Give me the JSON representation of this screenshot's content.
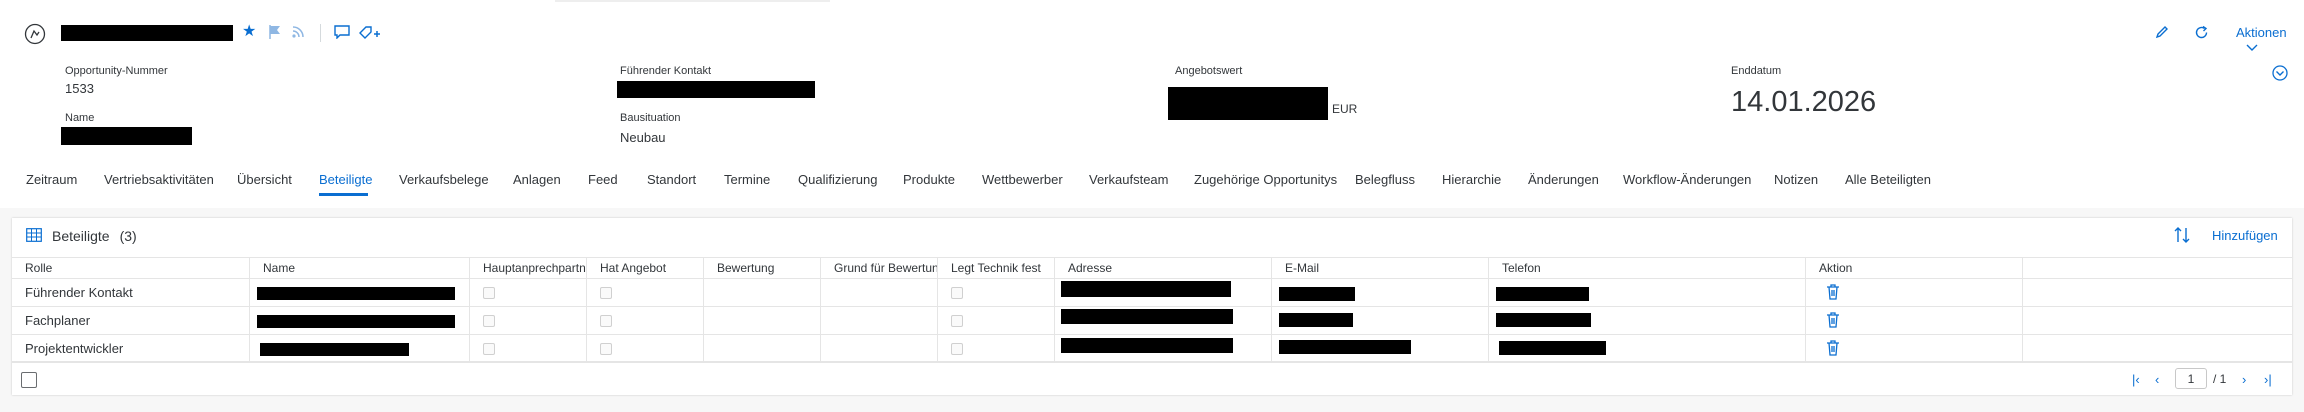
{
  "header": {
    "fields": {
      "opportunity_label": "Opportunity-Nummer",
      "opportunity_value": "1533",
      "name_label": "Name",
      "contact_label": "Führender Kontakt",
      "situation_label": "Bausituation",
      "situation_value": "Neubau",
      "offer_label": "Angebotswert",
      "offer_currency": "EUR",
      "end_label": "Enddatum",
      "end_value": "14.01.2026"
    },
    "actions_label": "Aktionen",
    "icons": [
      "star-icon",
      "flag-icon",
      "rss-icon",
      "comment-icon",
      "tag-add-icon",
      "edit-icon",
      "refresh-icon",
      "expand-icon"
    ]
  },
  "tabs": [
    "Zeitraum",
    "Vertriebsaktivitäten",
    "Übersicht",
    "Beteiligte",
    "Verkaufsbelege",
    "Anlagen",
    "Feed",
    "Standort",
    "Termine",
    "Qualifizierung",
    "Produkte",
    "Wettbewerber",
    "Verkaufsteam",
    "Zugehörige Opportunitys",
    "Belegfluss",
    "Hierarchie",
    "Änderungen",
    "Workflow-Änderungen",
    "Notizen",
    "Alle Beteiligten"
  ],
  "active_tab": "Beteiligte",
  "table": {
    "title": "Beteiligte",
    "count": "(3)",
    "add_label": "Hinzufügen",
    "columns": [
      "Rolle",
      "Name",
      "Hauptanprechpartner",
      "Hat Angebot",
      "Bewertung",
      "Grund für Bewertung",
      "Legt Technik fest",
      "Adresse",
      "E-Mail",
      "Telefon",
      "Aktion"
    ],
    "rows": [
      {
        "role": "Führender Kontakt"
      },
      {
        "role": "Fachplaner"
      },
      {
        "role": "Projektentwickler"
      }
    ]
  },
  "pager": {
    "page": "1",
    "total": "/ 1"
  },
  "colors": {
    "accent": "#0a6ed1",
    "text": "#32363a",
    "border": "#e5e5e5",
    "redaction": "#000000"
  }
}
